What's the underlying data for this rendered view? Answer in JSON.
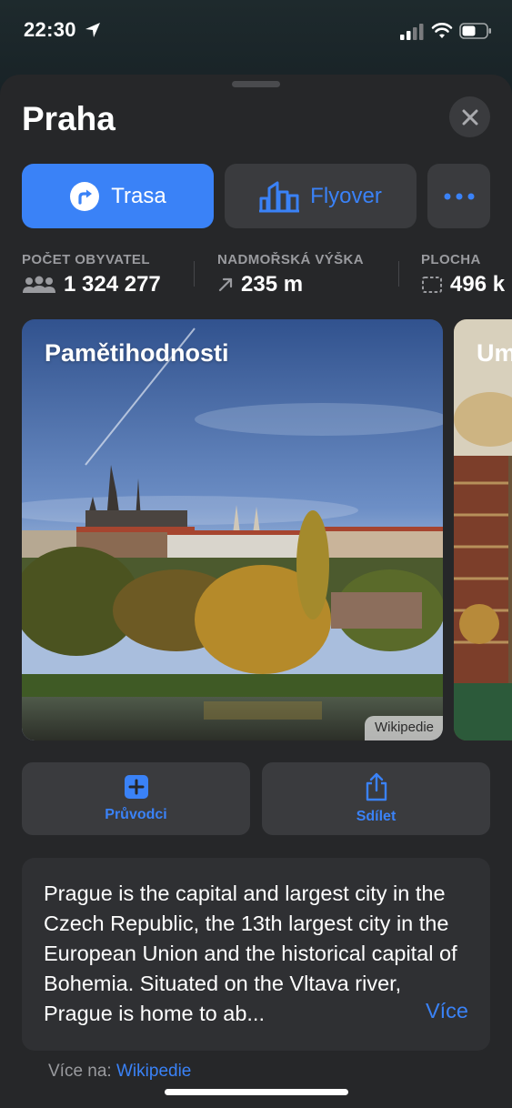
{
  "status": {
    "time": "22:30"
  },
  "place": {
    "title": "Praha"
  },
  "actions": {
    "route_label": "Trasa",
    "flyover_label": "Flyover"
  },
  "facts": [
    {
      "label": "POČET OBYVATEL",
      "value": "1 324 277",
      "icon": "people-icon"
    },
    {
      "label": "NADMOŘSKÁ VÝŠKA",
      "value": "235 m",
      "icon": "elevation-arrow-icon"
    },
    {
      "label": "PLOCHA",
      "value": "496 k",
      "icon": "area-icon"
    }
  ],
  "cards": {
    "main_title": "Pamětihodnosti",
    "main_credit": "Wikipedie",
    "next_title": "Um"
  },
  "tiles": {
    "guides_label": "Průvodci",
    "share_label": "Sdílet"
  },
  "description": {
    "text": "Prague is the capital and largest city in the Czech Republic, the 13th largest city in the European Union and the historical capital of Bohemia. Situated on the Vltava river, Prague is home to ab...",
    "more_label": "Více"
  },
  "source": {
    "prefix": "Více na: ",
    "link": "Wikipedie"
  },
  "colors": {
    "accent": "#3a82f7",
    "sheet": "#262729",
    "button": "#3a3b3e"
  }
}
